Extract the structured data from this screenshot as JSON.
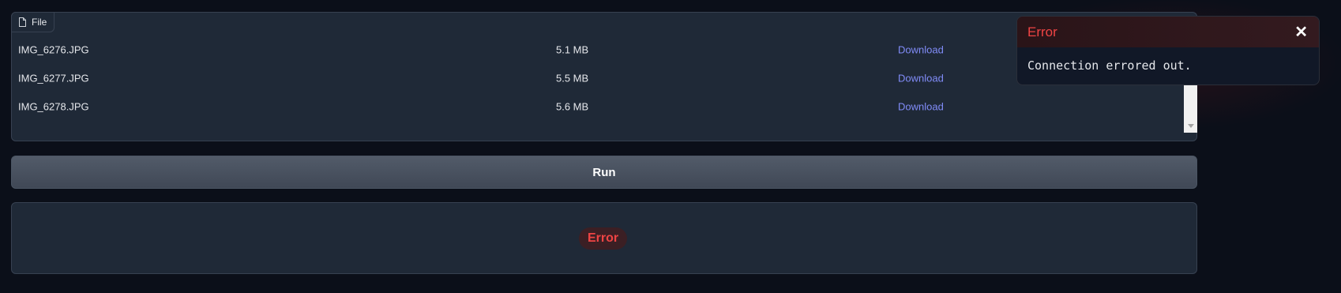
{
  "file_panel": {
    "label": "File",
    "files": [
      {
        "name": "IMG_6276.JPG",
        "size": "5.1 MB",
        "action": "Download"
      },
      {
        "name": "IMG_6277.JPG",
        "size": "5.5 MB",
        "action": "Download"
      },
      {
        "name": "IMG_6278.JPG",
        "size": "5.6 MB",
        "action": "Download"
      }
    ]
  },
  "run_button": {
    "label": "Run"
  },
  "output": {
    "status": "Error"
  },
  "toast": {
    "title": "Error",
    "close": "✕",
    "message": "Connection errored out."
  },
  "colors": {
    "background": "#0b0f19",
    "panel": "#1f2937",
    "link": "#818cf8",
    "error": "#ef4444"
  }
}
